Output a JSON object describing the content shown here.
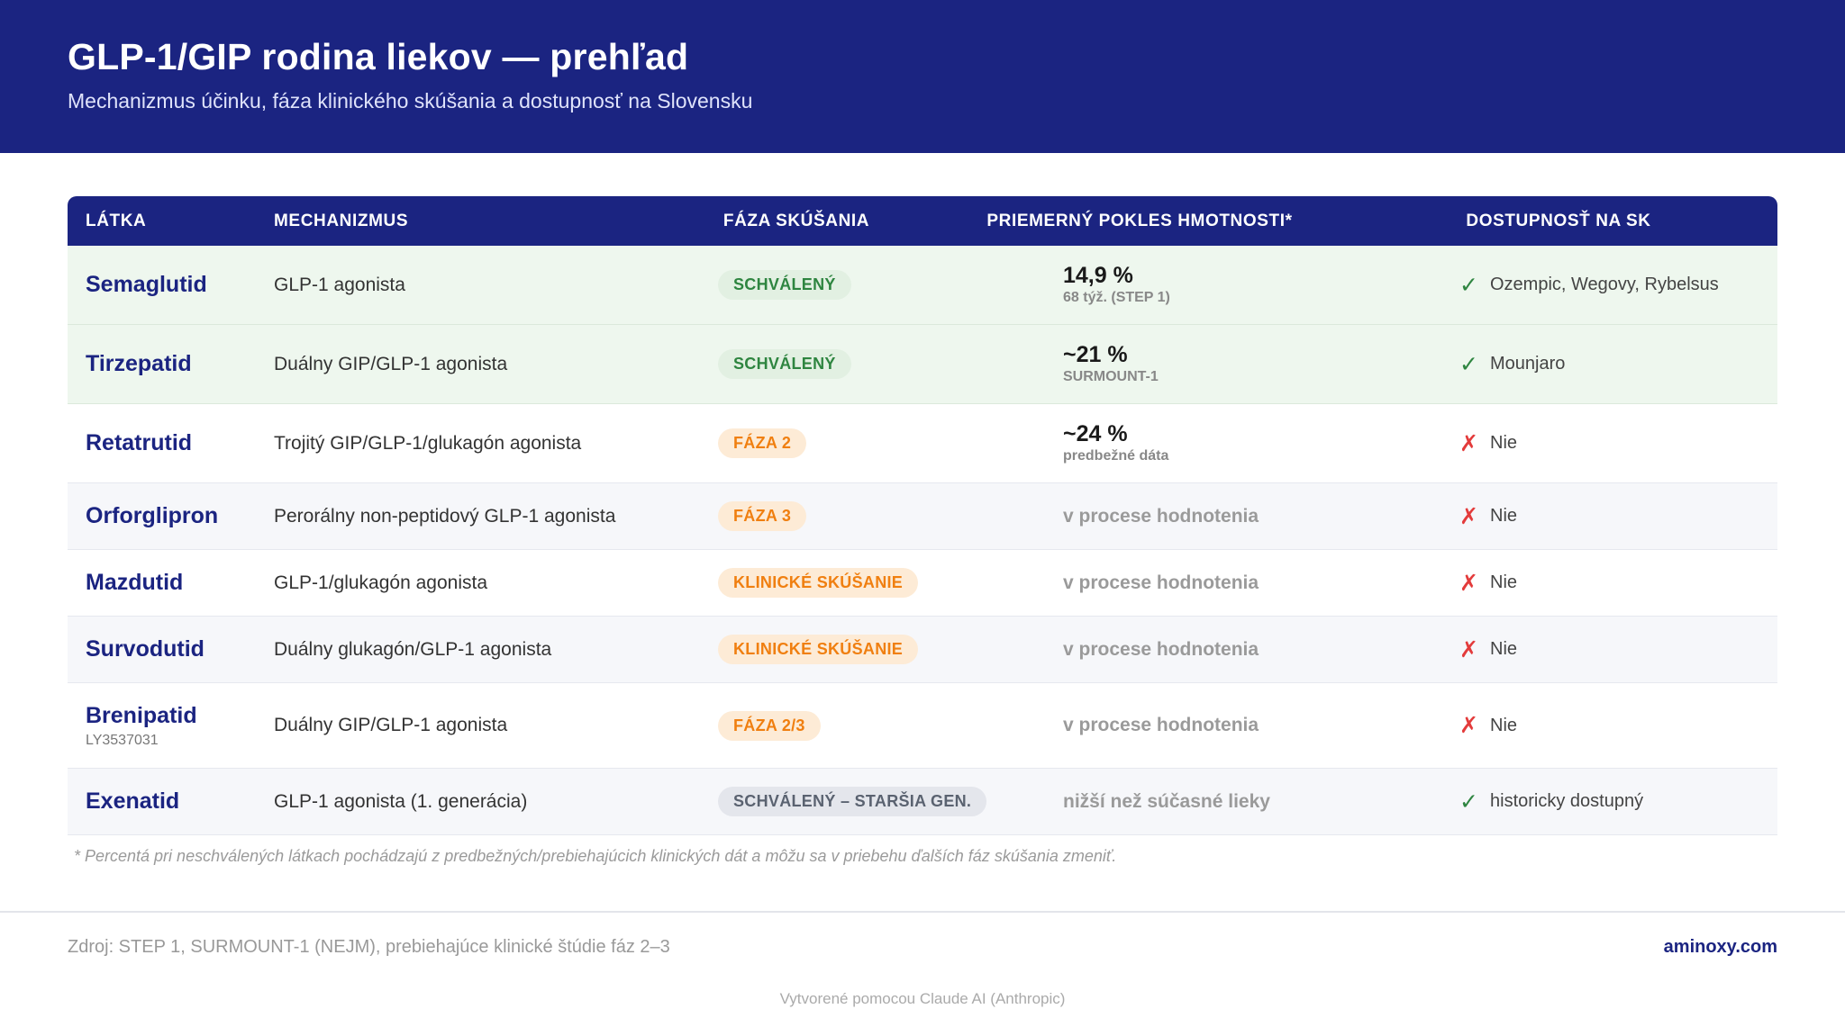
{
  "header": {
    "title": "GLP-1/GIP rodina liekov — prehľad",
    "subtitle": "Mechanizmus účinku, fáza klinického skúšania a dostupnosť na Slovensku"
  },
  "table": {
    "columns": [
      "LÁTKA",
      "MECHANIZMUS",
      "FÁZA SKÚŠANIA",
      "PRIEMERNÝ POKLES HMOTNOSTI*",
      "DOSTUPNOSŤ NA SK"
    ],
    "rows": [
      {
        "name": "Semaglutid",
        "code": "",
        "mechanism": "GLP-1 agonista",
        "phase": "SCHVÁLENÝ",
        "phase_status": "green",
        "weight": "14,9 %",
        "weight_note": "68 týž. (STEP 1)",
        "weight_pending": "",
        "avail_mark": "✓",
        "avail_ok": true,
        "availability": "Ozempic, Wegovy, Rybelsus"
      },
      {
        "name": "Tirzepatid",
        "code": "",
        "mechanism": "Duálny GIP/GLP-1 agonista",
        "phase": "SCHVÁLENÝ",
        "phase_status": "green",
        "weight": "~21 %",
        "weight_note": "SURMOUNT-1",
        "weight_pending": "",
        "avail_mark": "✓",
        "avail_ok": true,
        "availability": "Mounjaro"
      },
      {
        "name": "Retatrutid",
        "code": "",
        "mechanism": "Trojitý GIP/GLP-1/glukagón agonista",
        "phase": "FÁZA 2",
        "phase_status": "orange",
        "weight": "~24 %",
        "weight_note": "predbežné dáta",
        "weight_pending": "",
        "avail_mark": "✗",
        "avail_ok": false,
        "availability": "Nie"
      },
      {
        "name": "Orforglipron",
        "code": "",
        "mechanism": "Perorálny non-peptidový GLP-1 agonista",
        "phase": "FÁZA 3",
        "phase_status": "orange",
        "weight": "",
        "weight_note": "",
        "weight_pending": "v procese hodnotenia",
        "avail_mark": "✗",
        "avail_ok": false,
        "availability": "Nie"
      },
      {
        "name": "Mazdutid",
        "code": "",
        "mechanism": "GLP-1/glukagón agonista",
        "phase": "KLINICKÉ SKÚŠANIE",
        "phase_status": "orange",
        "weight": "",
        "weight_note": "",
        "weight_pending": "v procese hodnotenia",
        "avail_mark": "✗",
        "avail_ok": false,
        "availability": "Nie"
      },
      {
        "name": "Survodutid",
        "code": "",
        "mechanism": "Duálny glukagón/GLP-1 agonista",
        "phase": "KLINICKÉ SKÚŠANIE",
        "phase_status": "orange",
        "weight": "",
        "weight_note": "",
        "weight_pending": "v procese hodnotenia",
        "avail_mark": "✗",
        "avail_ok": false,
        "availability": "Nie"
      },
      {
        "name": "Brenipatid",
        "code": "LY3537031",
        "mechanism": "Duálny GIP/GLP-1 agonista",
        "phase": "FÁZA 2/3",
        "phase_status": "orange",
        "weight": "",
        "weight_note": "",
        "weight_pending": "v procese hodnotenia",
        "avail_mark": "✗",
        "avail_ok": false,
        "availability": "Nie"
      },
      {
        "name": "Exenatid",
        "code": "",
        "mechanism": "GLP-1 agonista (1. generácia)",
        "phase": "SCHVÁLENÝ – STARŠIA GEN.",
        "phase_status": "gray",
        "weight": "",
        "weight_note": "",
        "weight_pending": "nižší než súčasné lieky",
        "avail_mark": "✓",
        "avail_ok": true,
        "availability": "historicky dostupný"
      }
    ]
  },
  "footnote": "* Percentá pri neschválených látkach pochádzajú z predbežných/prebiehajúcich klinických dát a môžu sa v priebehu ďalších fáz skúšania zmeniť.",
  "footer": {
    "source": "Zdroj: STEP 1, SURMOUNT-1 (NEJM), prebiehajúce klinické štúdie fáz 2–3",
    "site": "aminoxy.com",
    "credit": "Vytvorené pomocou Claude AI (Anthropic)"
  },
  "colors": {
    "brand": "#1b2481",
    "approved_row": "#eef7ee",
    "badge_green": "#2e8540",
    "badge_orange": "#f07f10",
    "check": "#2e8540",
    "cross": "#e33b3b"
  }
}
